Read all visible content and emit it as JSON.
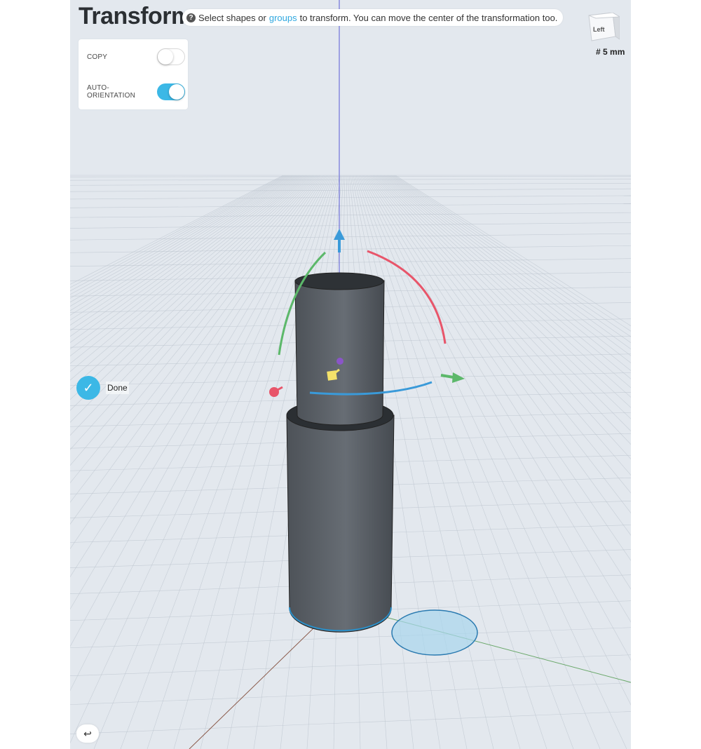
{
  "header": {
    "title": "Transform"
  },
  "hint": {
    "prefix": "Select shapes or",
    "link": "groups",
    "suffix": "to transform. You can move the center of the transformation too."
  },
  "options": {
    "copy": {
      "label": "COPY",
      "enabled": false
    },
    "auto_orientation": {
      "label": "AUTO-ORIENTATION",
      "enabled": true
    }
  },
  "done": {
    "label": "Done"
  },
  "view_cube": {
    "face_label": "Left"
  },
  "grid": {
    "size_label": "5 mm"
  },
  "icons": {
    "help": "help-icon",
    "check": "check-icon",
    "grid": "grid-icon",
    "undo": "undo-icon"
  },
  "colors": {
    "accent": "#3cb8e6",
    "axis_x": "#e8556a",
    "axis_y": "#5cb86a",
    "axis_z": "#3a9ad9"
  }
}
